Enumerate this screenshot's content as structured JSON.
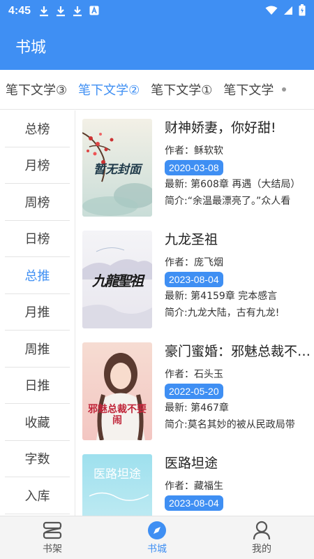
{
  "status": {
    "time": "4:45"
  },
  "app": {
    "title": "书城"
  },
  "tabs": [
    {
      "label": "笔下文学③"
    },
    {
      "label": "笔下文学②"
    },
    {
      "label": "笔下文学①"
    },
    {
      "label": "笔下文学"
    }
  ],
  "sidebar": {
    "items": [
      {
        "label": "总榜"
      },
      {
        "label": "月榜"
      },
      {
        "label": "周榜"
      },
      {
        "label": "日榜"
      },
      {
        "label": "总推"
      },
      {
        "label": "月推"
      },
      {
        "label": "周推"
      },
      {
        "label": "日推"
      },
      {
        "label": "收藏"
      },
      {
        "label": "字数"
      },
      {
        "label": "入库"
      }
    ]
  },
  "books": [
    {
      "title": "财神娇妻，你好甜!",
      "author": "作者：稣软软",
      "date": "2020-03-08",
      "latest": "最新: 第608章 再遇（大结局）",
      "intro": "简介:“余温最漂亮了。”众人看",
      "cover_text": "暂无封面"
    },
    {
      "title": "九龙圣祖",
      "author": "作者：庞飞烟",
      "date": "2023-08-04",
      "latest": "最新: 第4159章 完本感言",
      "intro": "简介:九龙大陆，古有九龙!",
      "cover_text": "九龍聖祖"
    },
    {
      "title": "豪门蜜婚：邪魅总裁不要闹",
      "author": "作者：石头玉",
      "date": "2022-05-20",
      "latest": "最新: 第467章",
      "intro": "简介:莫名其妙的被从民政局带",
      "cover_text": "邪魅总裁不要闹"
    },
    {
      "title": "医路坦途",
      "author": "作者：藏福生",
      "date": "2023-08-04",
      "latest": "",
      "intro": "",
      "cover_text": "医路坦途"
    }
  ],
  "nav": [
    {
      "label": "书架",
      "icon": "bookshelf-icon"
    },
    {
      "label": "书城",
      "icon": "compass-icon"
    },
    {
      "label": "我的",
      "icon": "person-icon"
    }
  ],
  "colors": {
    "primary": "#3f8ff3"
  }
}
